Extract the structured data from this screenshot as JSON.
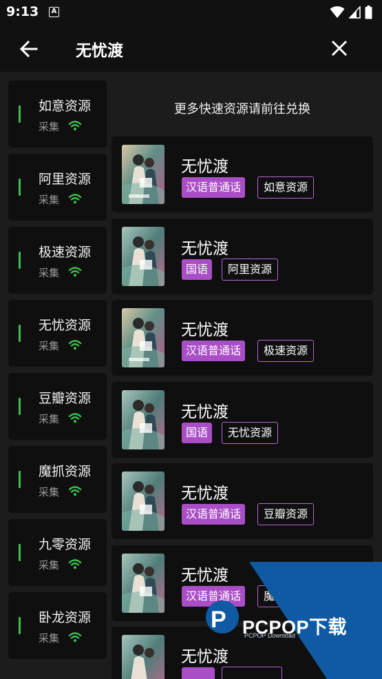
{
  "status_bar": {
    "time": "9:13",
    "notification_letter": "A"
  },
  "app_bar": {
    "title": "无忧渡"
  },
  "sidebar": {
    "items": [
      {
        "name": "如意资源",
        "sub": "采集"
      },
      {
        "name": "阿里资源",
        "sub": "采集"
      },
      {
        "name": "极速资源",
        "sub": "采集"
      },
      {
        "name": "无忧资源",
        "sub": "采集"
      },
      {
        "name": "豆瓣资源",
        "sub": "采集"
      },
      {
        "name": "魔抓资源",
        "sub": "采集"
      },
      {
        "name": "九零资源",
        "sub": "采集"
      },
      {
        "name": "卧龙资源",
        "sub": "采集"
      }
    ]
  },
  "main": {
    "tip": "更多快速资源请前往兑换",
    "results": [
      {
        "title": "无忧渡",
        "lang": "汉语普通话",
        "source": "如意资源"
      },
      {
        "title": "无忧渡",
        "lang": "国语",
        "source": "阿里资源"
      },
      {
        "title": "无忧渡",
        "lang": "汉语普通话",
        "source": "极速资源"
      },
      {
        "title": "无忧渡",
        "lang": "国语",
        "source": "无忧资源"
      },
      {
        "title": "无忧渡",
        "lang": "汉语普通话",
        "source": "豆瓣资源"
      },
      {
        "title": "无忧渡",
        "lang": "汉语普通话",
        "source": "魔"
      },
      {
        "title": "无忧渡",
        "lang": "",
        "source": ""
      }
    ]
  },
  "watermark": {
    "brand": "PCPOP下载",
    "sub": "PCPOP Download"
  },
  "colors": {
    "background": "#111111",
    "panel": "#1c1c1c",
    "card": "#0f0f0f",
    "accent_purple": "#a94ec6",
    "signal_green": "#3fbf4f",
    "watermark_blue": "#0f5aa3"
  }
}
